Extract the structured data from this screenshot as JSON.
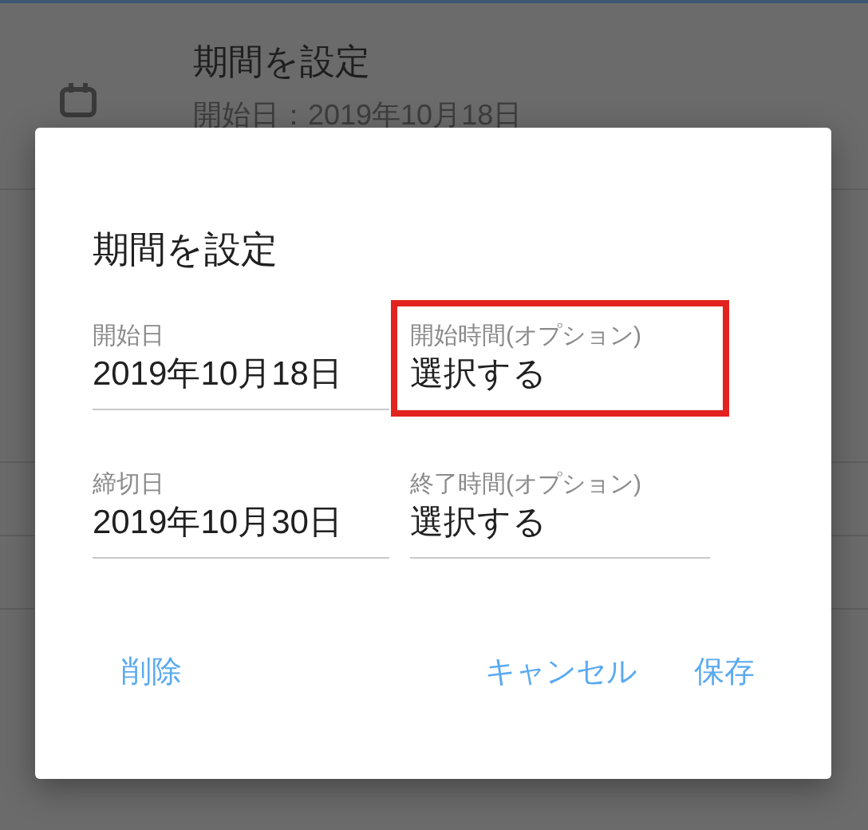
{
  "list_item": {
    "title": "期間を設定",
    "subtitle": "開始日：2019年10月18日"
  },
  "dialog": {
    "title": "期間を設定",
    "fields": [
      {
        "label": "開始日",
        "value": "2019年10月18日",
        "highlighted": false
      },
      {
        "label": "開始時間(オプション)",
        "value": "選択する",
        "highlighted": true
      },
      {
        "label": "締切日",
        "value": "2019年10月30日",
        "highlighted": false
      },
      {
        "label": "終了時間(オプション)",
        "value": "選択する",
        "highlighted": false
      }
    ],
    "buttons": [
      {
        "label": "削除",
        "kind": "left"
      },
      {
        "label": "キャンセル",
        "kind": "right"
      },
      {
        "label": "保存",
        "kind": "right"
      }
    ]
  }
}
